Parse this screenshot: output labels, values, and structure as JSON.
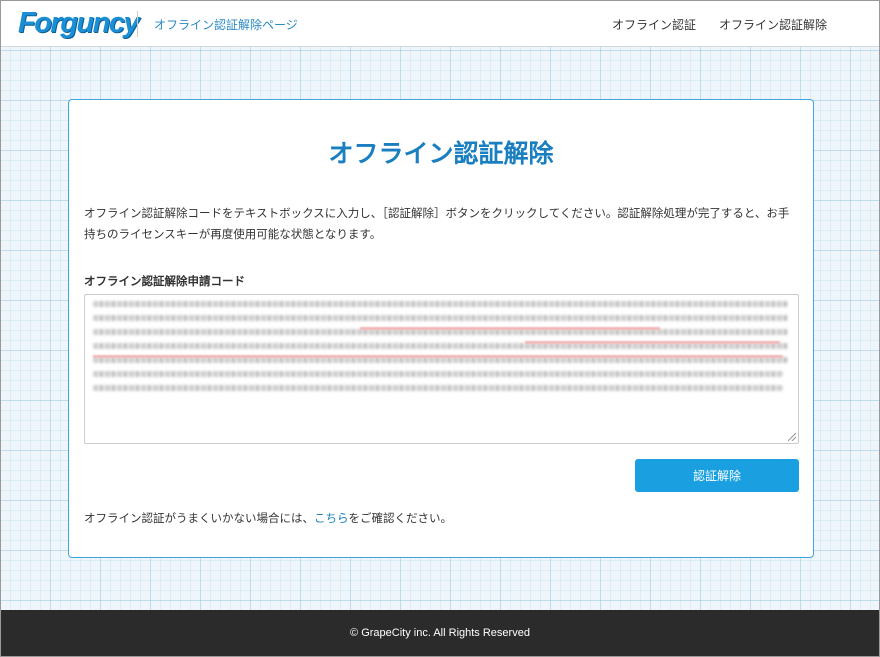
{
  "header": {
    "logo_text": "Forguncy",
    "page_name": "オフライン認証解除ページ",
    "nav": [
      "オフライン認証",
      "オフライン認証解除"
    ]
  },
  "main": {
    "title": "オフライン認証解除",
    "description": "オフライン認証解除コードをテキストボックスに入力し、［認証解除］ボタンをクリックしてください。認証解除処理が完了すると、お手持ちのライセンスキーが再度使用可能な状態となります。",
    "code_label": "オフライン認証解除申請コード",
    "submit_label": "認証解除",
    "help": {
      "prefix": "オフライン認証がうまくいかない場合には、",
      "link": "こちら",
      "suffix": "をご確認ください。"
    }
  },
  "footer": {
    "copyright": "© GrapeCity inc. All Rights Reserved"
  },
  "colors": {
    "accent": "#1a7fc0",
    "button": "#1aa0e0",
    "footer": "#2b2b2b"
  }
}
